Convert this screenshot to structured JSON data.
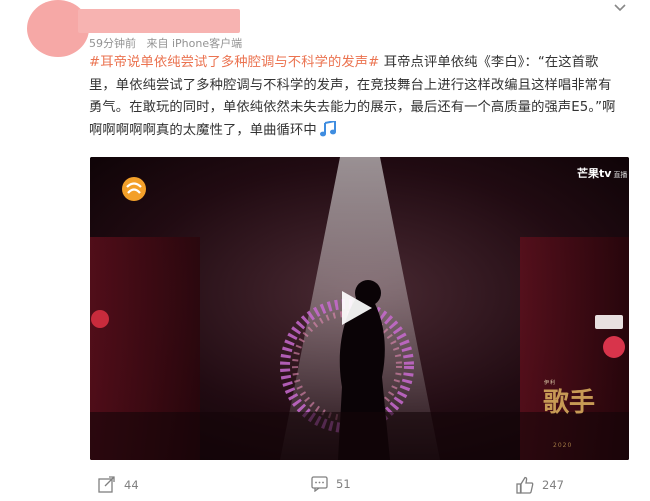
{
  "post": {
    "meta": {
      "time": "59分钟前",
      "source": "来自 iPhone客户端"
    },
    "hashtag": "#耳帝说单依纯尝试了多种腔调与不科学的发声#",
    "body": " 耳帝点评单依纯《李白》：“在这首歌里，单依纯尝试了多种腔调与不科学的发声，在竞技舞台上进行这样改编且这样唱非常有勇气。在敢玩的同时，单依纯依然未失去能力的展示，最后还有一个高质量的强声E5。”啊啊啊啊啊啊真的太魔性了，单曲循环中"
  },
  "video": {
    "watermark": "芒果tv",
    "watermark_sub": "直播",
    "show_logo_text": "歌手",
    "show_year": "2020",
    "sponsor": "伊利"
  },
  "actions": {
    "forward_count": "44",
    "comment_count": "51",
    "like_count": "247"
  },
  "colors": {
    "hashtag": "#eb7350",
    "avatar": "#f6a8a6",
    "text": "#333333",
    "meta": "#939393",
    "background": "#ffffff"
  },
  "icons": [
    "more-icon",
    "music-note-icon",
    "channel-logo-icon",
    "play-icon",
    "forward-icon",
    "comment-icon",
    "like-icon"
  ]
}
